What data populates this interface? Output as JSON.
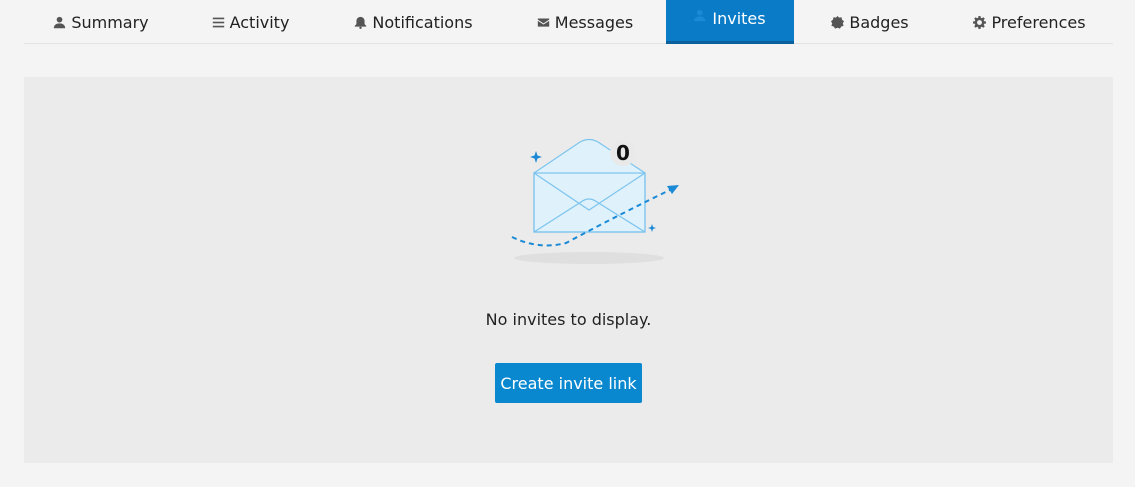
{
  "nav": {
    "tabs": [
      {
        "label": "Summary",
        "icon": "user-icon"
      },
      {
        "label": "Activity",
        "icon": "list-icon"
      },
      {
        "label": "Notifications",
        "icon": "bell-icon"
      },
      {
        "label": "Messages",
        "icon": "envelope-icon"
      },
      {
        "label": "Invites",
        "icon": "user-plus-icon",
        "active": true
      },
      {
        "label": "Badges",
        "icon": "badge-icon"
      },
      {
        "label": "Preferences",
        "icon": "gear-icon"
      }
    ]
  },
  "main": {
    "invite_count": "0",
    "empty_message": "No invites to display.",
    "create_button_label": "Create invite link"
  },
  "colors": {
    "accent": "#0a88cf",
    "active_tab": "#0a7bc6",
    "panel_bg": "#ebebeb",
    "page_bg": "#f4f4f4"
  }
}
